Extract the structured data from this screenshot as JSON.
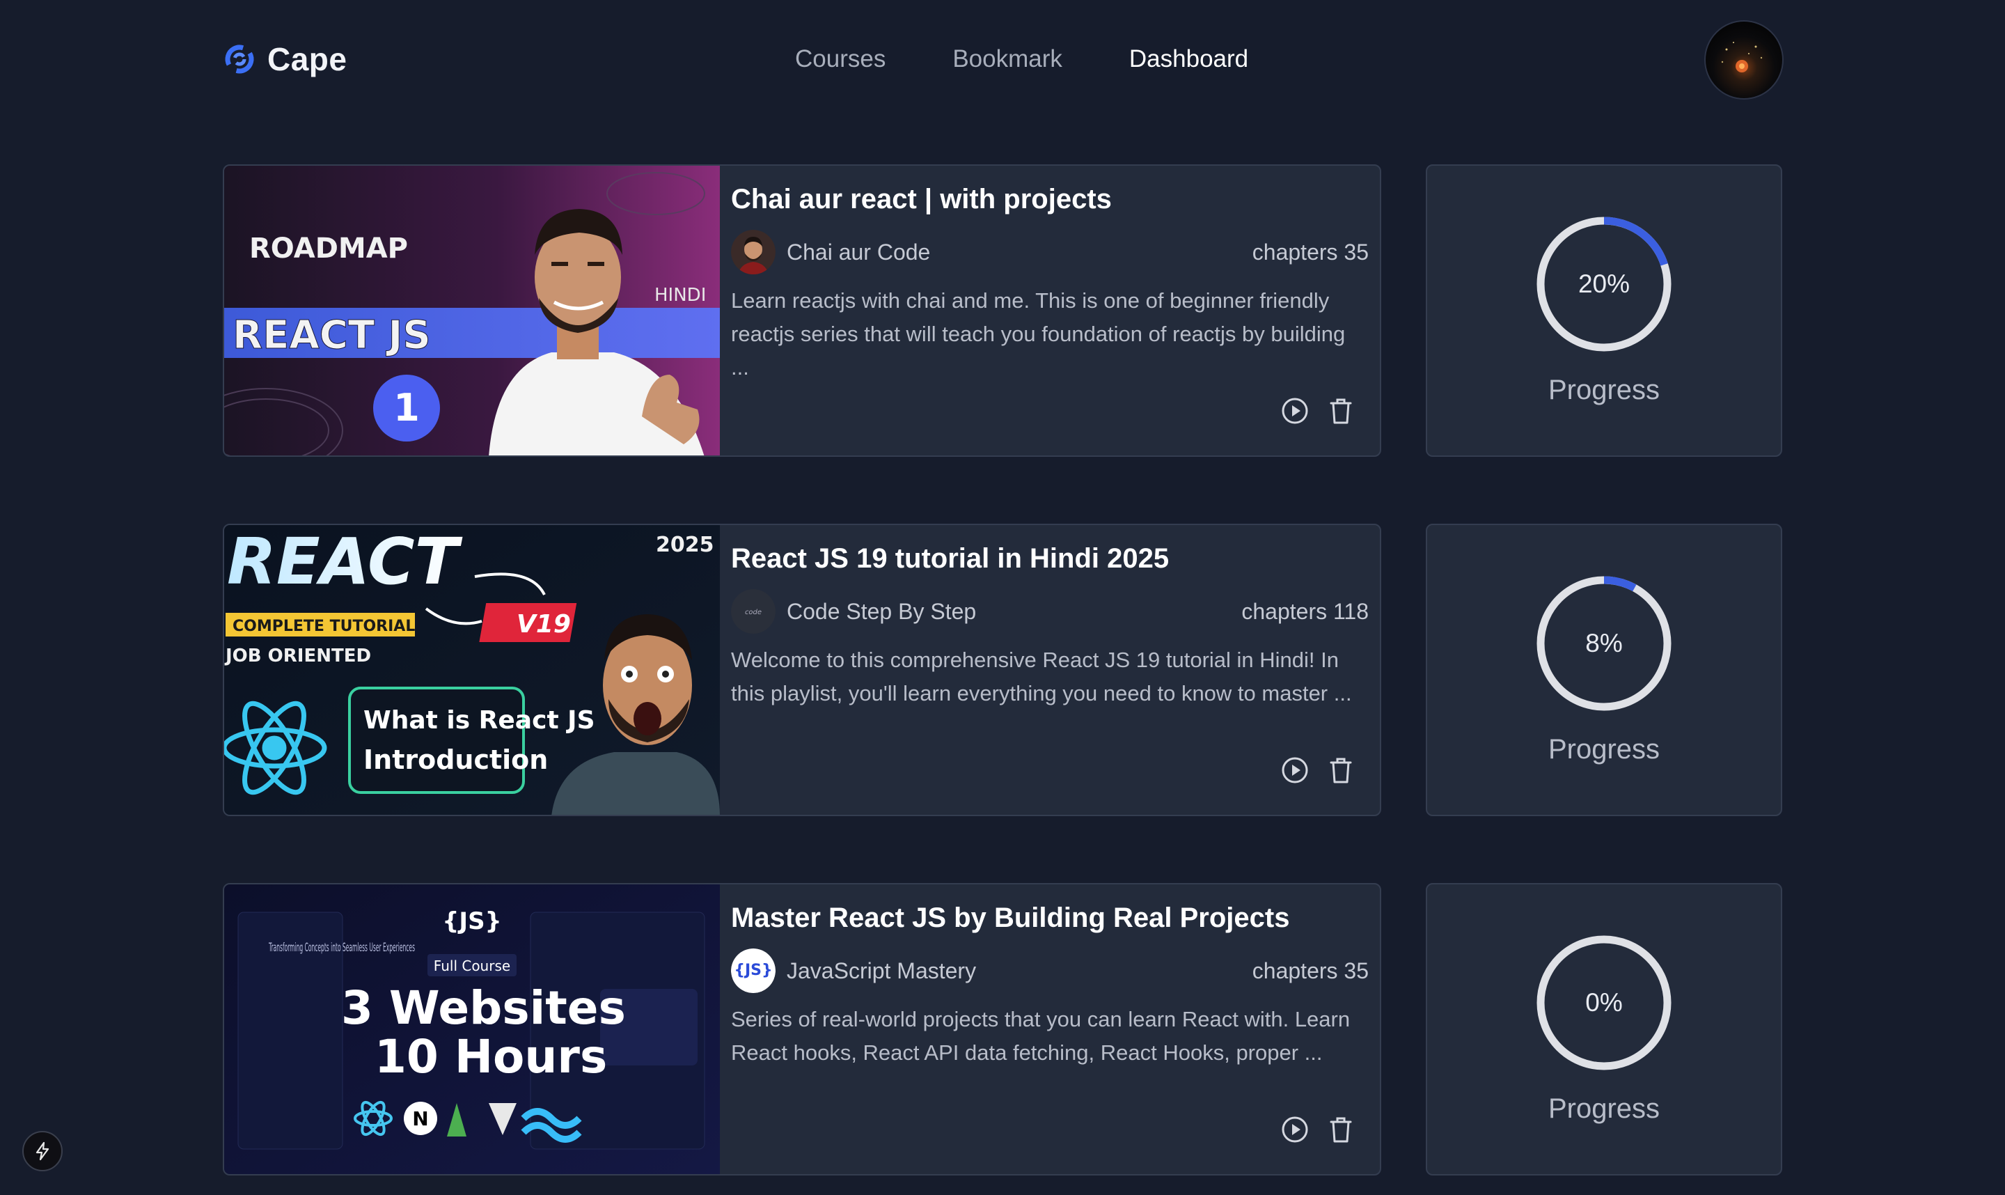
{
  "brand": {
    "name": "Cape",
    "accent": "#3b6ff5"
  },
  "nav": {
    "links": [
      {
        "label": "Courses",
        "active": false
      },
      {
        "label": "Bookmark",
        "active": false
      },
      {
        "label": "Dashboard",
        "active": true
      }
    ]
  },
  "courses": [
    {
      "title": "Chai aur react | with projects",
      "author": "Chai aur Code",
      "chapters": "chapters 35",
      "description": "Learn reactjs with chai and me. This is one of beginner friendly reactjs series that will teach you foundation of reactjs by building ...",
      "progress_pct": 20,
      "progress_text": "20%",
      "progress_label": "Progress",
      "thumbnail": {
        "line1": "ROADMAP",
        "line2": "REACT JS",
        "badge": "1",
        "tag": "HINDI"
      }
    },
    {
      "title": "React JS 19 tutorial in Hindi 2025",
      "author": "Code Step By Step",
      "chapters": "chapters 118",
      "description": "Welcome to this comprehensive React JS 19 tutorial in Hindi! In this playlist, you'll learn everything you need to know to master ...",
      "progress_pct": 8,
      "progress_text": "8%",
      "progress_label": "Progress",
      "thumbnail": {
        "line1": "REACT",
        "year": "2025",
        "tag1": "COMPLETE TUTORIAL",
        "tag2": "V19",
        "tag3": "JOB ORIENTED",
        "box1": "What is React JS",
        "box2": "Introduction"
      }
    },
    {
      "title": "Master React JS by Building Real Projects",
      "author": "JavaScript Mastery",
      "chapters": "chapters 35",
      "description": "Series of real-world projects that you can learn React with. Learn React hooks, React API data fetching, React Hooks, proper ...",
      "progress_pct": 0,
      "progress_text": "0%",
      "progress_label": "Progress",
      "thumbnail": {
        "line1": "3 Websites",
        "line2": "10 Hours",
        "tag": "Full Course",
        "tagline": "Transforming Concepts into Seamless User Experiences"
      }
    }
  ],
  "icons": {
    "play": "play-circle-icon",
    "delete": "trash-icon",
    "bolt": "lightning-bolt-icon"
  },
  "colors": {
    "background": "#161c2c",
    "card": "#232b3b",
    "progress_track": "#dfe1e6",
    "progress_fill": "#3b5fe0"
  }
}
